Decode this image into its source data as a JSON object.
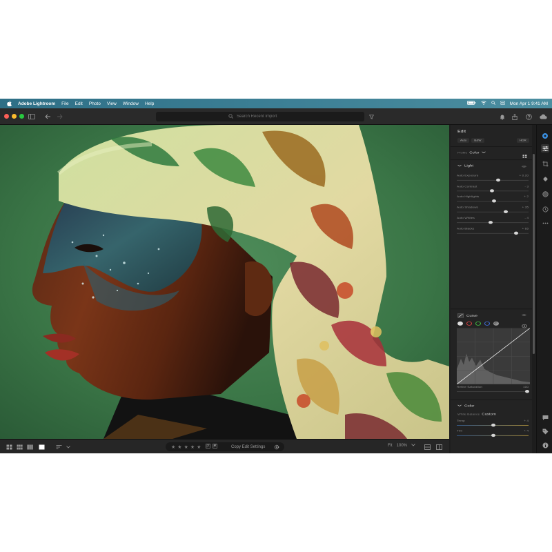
{
  "menubar": {
    "app_name": "Adobe Lightroom",
    "items": [
      "File",
      "Edit",
      "Photo",
      "View",
      "Window",
      "Help"
    ],
    "clock": "Mon Apr 1  9:41 AM"
  },
  "toolbar": {
    "search_placeholder": "Search Recent Import"
  },
  "panel": {
    "title": "Edit",
    "presets": [
      "Auto",
      "B&W"
    ],
    "hdr_label": "HDR",
    "profile_label": "Profile",
    "profile_value": "Color",
    "light": {
      "title": "Light",
      "sliders": [
        {
          "label": "Auto Exposure",
          "value": "+ 0.20",
          "pos": 0.58
        },
        {
          "label": "Auto Contrast",
          "value": "- 3",
          "pos": 0.49
        },
        {
          "label": "Auto Highlights",
          "value": "+ 2",
          "pos": 0.52
        },
        {
          "label": "Auto Shadows",
          "value": "+ 35",
          "pos": 0.68
        },
        {
          "label": "Auto Whites",
          "value": "- 4",
          "pos": 0.47
        },
        {
          "label": "Auto Blacks",
          "value": "+ 65",
          "pos": 0.83
        }
      ]
    },
    "curve": {
      "title": "Curve",
      "refine_label": "Refine Saturation",
      "refine_value": "100",
      "refine_pos": 0.98
    },
    "color": {
      "title": "Color",
      "wb_label": "White Balance",
      "wb_value": "Custom",
      "sliders": [
        {
          "label": "Temp",
          "value": "+ 4",
          "pos": 0.51
        },
        {
          "label": "Tint",
          "value": "+ 4",
          "pos": 0.51
        }
      ]
    }
  },
  "bottombar": {
    "copy_label": "Copy Edit Settings",
    "fit_label": "Fit",
    "zoom_value": "100%"
  },
  "colors": {
    "menubar": "#3c7f95",
    "panel_bg": "#232323",
    "photo_bg": "#3f7a4a"
  }
}
